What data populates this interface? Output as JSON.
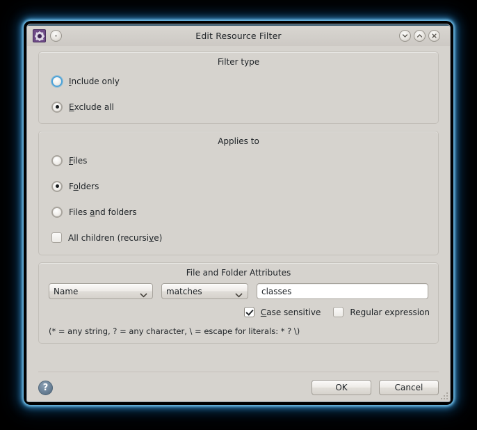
{
  "window": {
    "title": "Edit Resource Filter",
    "app_icon": "gear-icon",
    "titlebar_buttons": [
      {
        "name": "minimize",
        "glyph": "chevron-down"
      },
      {
        "name": "maximize",
        "glyph": "chevron-up"
      },
      {
        "name": "close",
        "glyph": "x"
      }
    ]
  },
  "filter_type": {
    "title": "Filter type",
    "options": [
      {
        "label": "Include only",
        "mnemonic": "I",
        "selected": false,
        "focused": true
      },
      {
        "label": "Exclude all",
        "mnemonic": "E",
        "selected": true,
        "focused": false
      }
    ]
  },
  "applies_to": {
    "title": "Applies to",
    "options": [
      {
        "label": "Files",
        "selected": false
      },
      {
        "label": "Folders",
        "selected": true
      },
      {
        "label": "Files and folders",
        "selected": false
      }
    ],
    "recursive": {
      "label": "All children (recursive)",
      "checked": false
    }
  },
  "attributes": {
    "title": "File and Folder Attributes",
    "attribute_select": {
      "value": "Name"
    },
    "operator_select": {
      "value": "matches"
    },
    "pattern_input": {
      "value": "classes",
      "placeholder": ""
    },
    "case_sensitive": {
      "label": "Case sensitive",
      "checked": true
    },
    "regular_expression": {
      "label": "Regular expression",
      "checked": false
    },
    "hint": "(* = any string, ? = any character, \\ = escape for literals: * ? \\)"
  },
  "footer": {
    "help_glyph": "?",
    "ok_label": "OK",
    "cancel_label": "Cancel"
  }
}
